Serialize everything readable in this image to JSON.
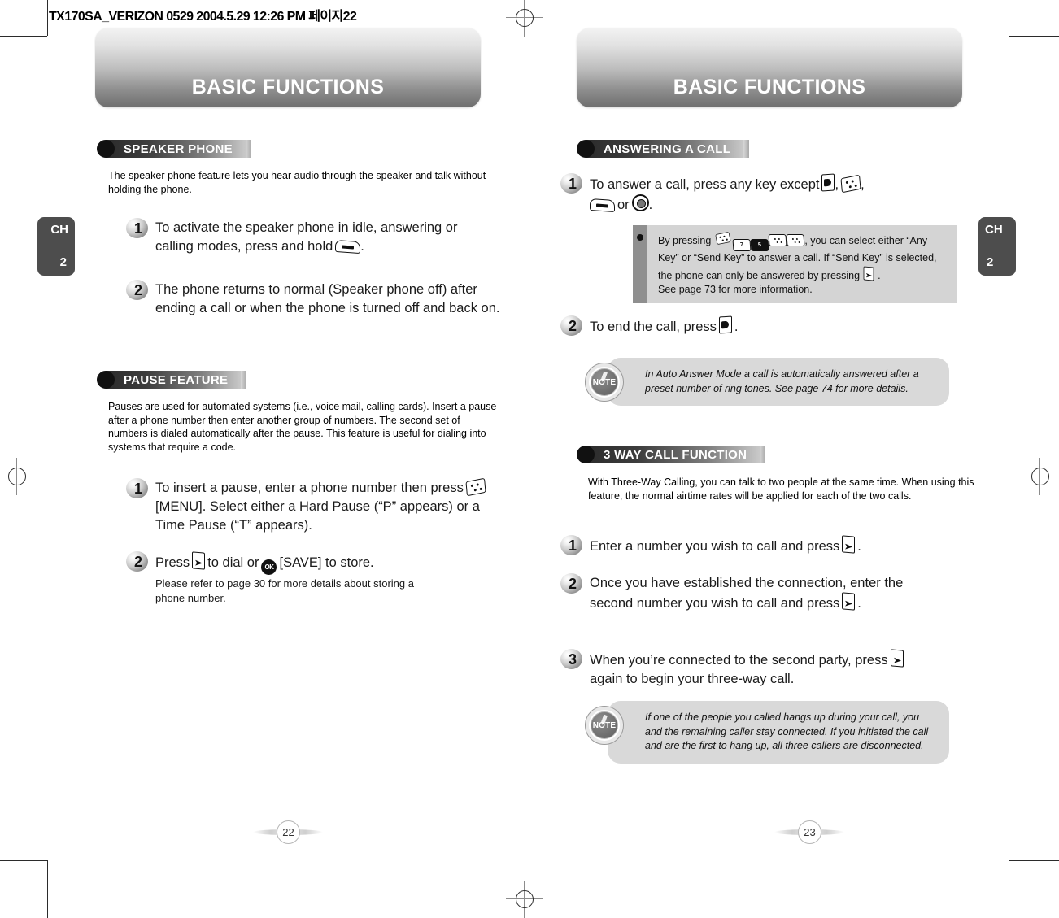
{
  "document": {
    "code_line": "TX170SA_VERIZON 0529  2004.5.29 12:26 PM  페이지22"
  },
  "left_page": {
    "banner_title": "BASIC FUNCTIONS",
    "chapter_tab": {
      "letters": "CH",
      "number": "2"
    },
    "page_number": "22",
    "sections": [
      {
        "heading": "SPEAKER PHONE",
        "intro": "The speaker phone feature lets you hear audio through the speaker and talk without holding the phone.",
        "steps": [
          {
            "number": "1",
            "text_before": "To activate the speaker phone in idle, answering or calling modes, press and hold",
            "icon": "quick-key-icon",
            "text_after": "."
          },
          {
            "number": "2",
            "text_before": "The phone returns to normal (Speaker phone off) after ending a call or when the phone is turned off and back on.",
            "icon": "",
            "text_after": ""
          }
        ]
      },
      {
        "heading": "PAUSE FEATURE",
        "intro": "Pauses are used for automated systems (i.e., voice mail, calling cards). Insert a pause after a phone number then enter another group of numbers. The second set of numbers is dialed automatically after the pause. This feature is useful for dialing into systems that require a code.",
        "steps": [
          {
            "number": "1",
            "text_a": "To insert a pause, enter a phone number then press",
            "icon_1": "menu-key-icon",
            "text_b": "[MENU]. Select either a Hard Pause (“P” appears) or a Time Pause (“T” appears)."
          },
          {
            "number": "2",
            "text_a": "Press",
            "icon_1": "send-key-icon",
            "text_b": "to dial or",
            "icon_2": "ok-key-icon",
            "text_c": "[SAVE] to store.",
            "subtext": "Please refer to page 30 for more details about storing a phone number."
          }
        ]
      }
    ]
  },
  "right_page": {
    "banner_title": "BASIC FUNCTIONS",
    "chapter_tab": {
      "letters": "CH",
      "number": "2"
    },
    "page_number": "23",
    "sections": [
      {
        "heading": "ANSWERING A CALL",
        "steps": [
          {
            "number": "1",
            "text_a": "To answer a call, press any key except",
            "icon_1": "end-key-icon",
            "sep_1": ",",
            "icon_2": "menu-key-icon",
            "sep_2": ",",
            "icon_3": "quick-key-icon",
            "text_b": "or",
            "icon_4": "nav-key-icon",
            "text_c": "."
          },
          {
            "number": "2",
            "text_a": "To end the call, press",
            "icon_1": "end-key-icon",
            "text_b": "."
          }
        ],
        "callout": {
          "text_a": "By pressing",
          "keys": [
            "menu-key-icon",
            "7-key-icon",
            "5-key-icon",
            "down-key-icon",
            "down-key-icon"
          ],
          "text_b": ", you can select either “Any Key” or “Send Key” to answer a call. If “Send Key” is selected, the phone can only be answered by pressing",
          "icon_send": "send-key-icon",
          "text_c": ".",
          "text_d": "See page 73 for more information."
        },
        "note": {
          "label": "NOTE",
          "text": "In Auto Answer Mode a call is automatically answered after a preset number of ring tones. See page 74 for more details."
        }
      },
      {
        "heading": "3 WAY CALL FUNCTION",
        "intro": "With Three-Way Calling, you can talk to two people at the same time. When using this feature, the normal airtime rates will be applied for each of the two calls.",
        "steps": [
          {
            "number": "1",
            "text_a": "Enter a number you wish to call and press",
            "icon_1": "send-key-icon",
            "text_b": "."
          },
          {
            "number": "2",
            "text_a": "Once you have established the connection, enter the second number you wish to call and press",
            "icon_1": "send-key-icon",
            "text_b": "."
          },
          {
            "number": "3",
            "text_a": "When you’re connected to the second party, press",
            "icon_1": "send-key-icon",
            "text_b": "again to begin your three-way call."
          }
        ],
        "note": {
          "label": "NOTE",
          "text": "If one of the people you called hangs up during your call, you and the remaining caller stay connected. If you initiated the call and are the first to hang up, all three callers are disconnected."
        }
      }
    ]
  },
  "key_labels": {
    "ok": "OK",
    "num7": "7",
    "num5": "5"
  }
}
